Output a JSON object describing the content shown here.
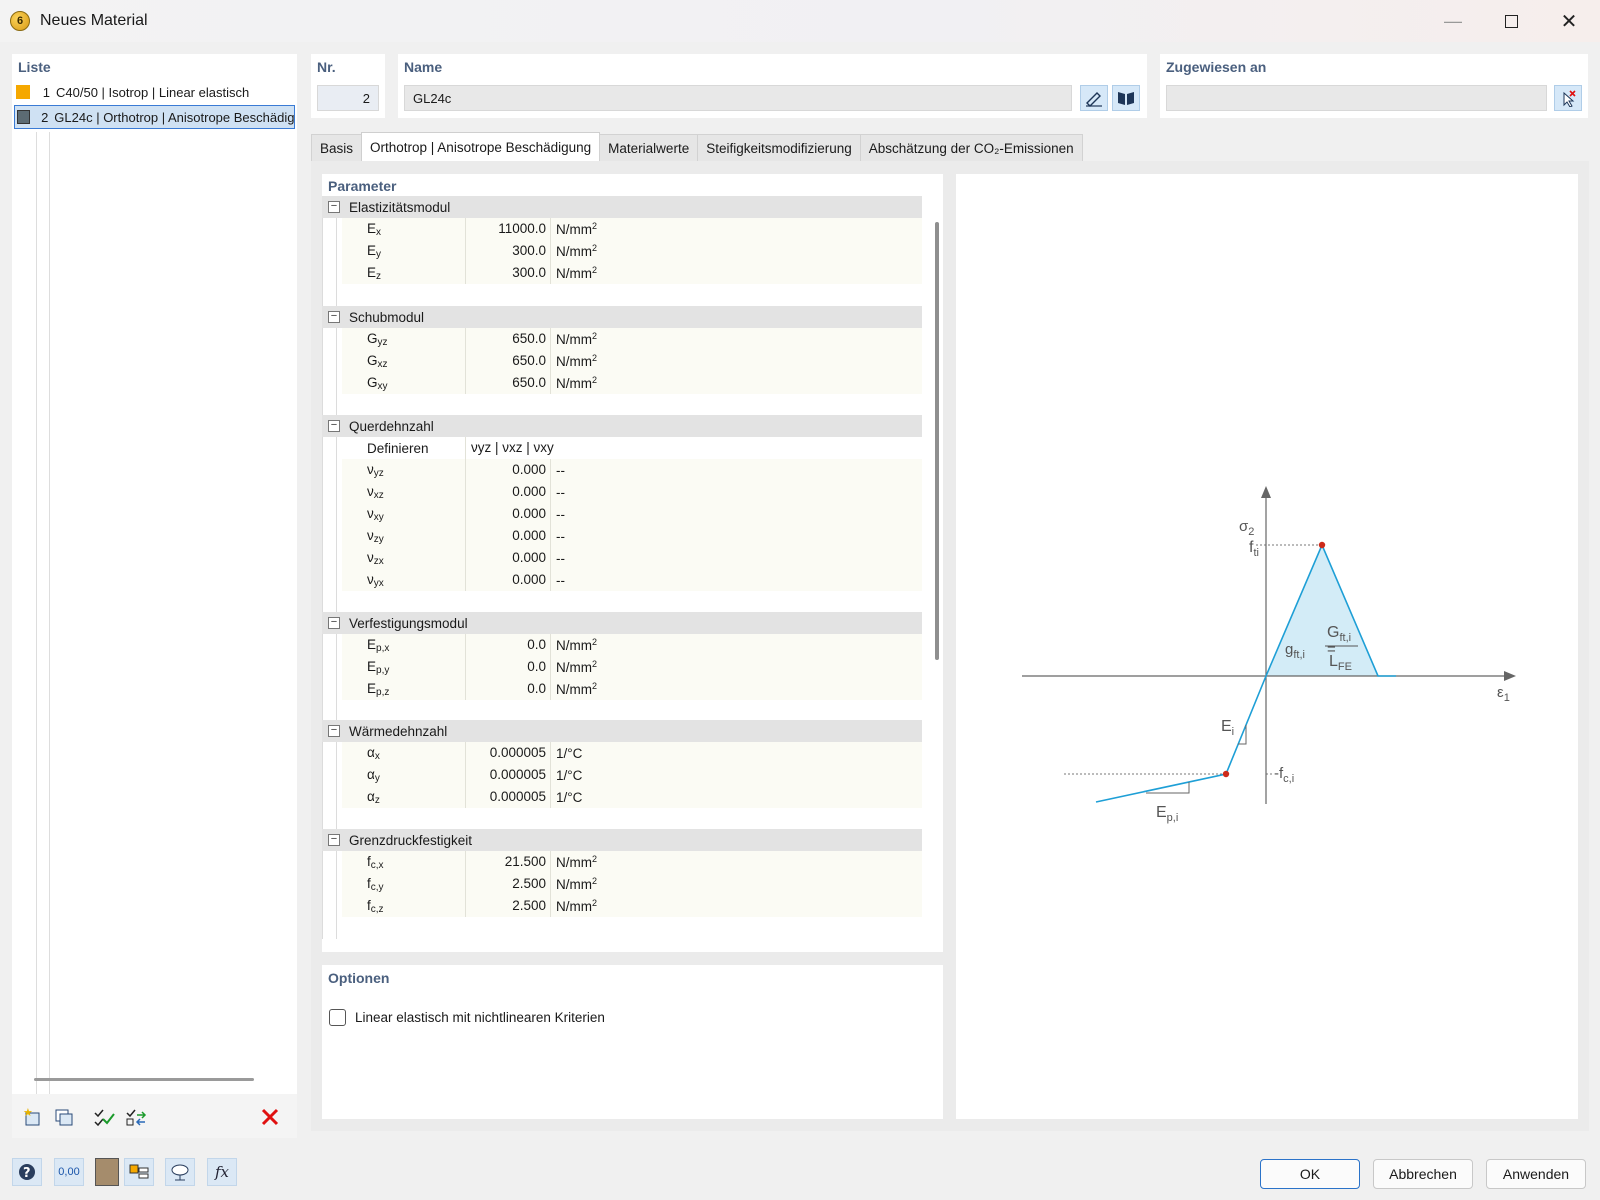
{
  "window": {
    "title": "Neues Material",
    "app_icon_glyph": "6"
  },
  "list": {
    "label": "Liste",
    "items": [
      {
        "num": "1",
        "text": "C40/50 | Isotrop | Linear elastisch",
        "color": "#f5a800"
      },
      {
        "num": "2",
        "text": "GL24c | Orthotrop | Anisotrope Beschädigung",
        "color": "#5c6b73"
      }
    ]
  },
  "header": {
    "nr_label": "Nr.",
    "nr_value": "2",
    "name_label": "Name",
    "name_value": "GL24c",
    "assigned_label": "Zugewiesen an",
    "assigned_value": ""
  },
  "tabs": [
    "Basis",
    "Orthotrop | Anisotrope Beschädigung",
    "Materialwerte",
    "Steifigkeitsmodifizierung",
    "Abschätzung der CO₂-Emissionen"
  ],
  "parameters": {
    "label": "Parameter",
    "sections": [
      {
        "title": "Elastizitätsmodul",
        "rows": [
          {
            "sym": "E",
            "sub": "x",
            "value": "11000.0",
            "unit": "N/mm",
            "exp": "2"
          },
          {
            "sym": "E",
            "sub": "y",
            "value": "300.0",
            "unit": "N/mm",
            "exp": "2"
          },
          {
            "sym": "E",
            "sub": "z",
            "value": "300.0",
            "unit": "N/mm",
            "exp": "2"
          }
        ]
      },
      {
        "title": "Schubmodul",
        "rows": [
          {
            "sym": "G",
            "sub": "yz",
            "value": "650.0",
            "unit": "N/mm",
            "exp": "2"
          },
          {
            "sym": "G",
            "sub": "xz",
            "value": "650.0",
            "unit": "N/mm",
            "exp": "2"
          },
          {
            "sym": "G",
            "sub": "xy",
            "value": "650.0",
            "unit": "N/mm",
            "exp": "2"
          }
        ]
      },
      {
        "title": "Querdehnzahl",
        "define_label": "Definieren",
        "define_value": "νyz | νxz | νxy",
        "rows": [
          {
            "sym": "ν",
            "sub": "yz",
            "value": "0.000",
            "unit": "--",
            "exp": ""
          },
          {
            "sym": "ν",
            "sub": "xz",
            "value": "0.000",
            "unit": "--",
            "exp": ""
          },
          {
            "sym": "ν",
            "sub": "xy",
            "value": "0.000",
            "unit": "--",
            "exp": ""
          },
          {
            "sym": "ν",
            "sub": "zy",
            "value": "0.000",
            "unit": "--",
            "exp": ""
          },
          {
            "sym": "ν",
            "sub": "zx",
            "value": "0.000",
            "unit": "--",
            "exp": ""
          },
          {
            "sym": "ν",
            "sub": "yx",
            "value": "0.000",
            "unit": "--",
            "exp": ""
          }
        ]
      },
      {
        "title": "Verfestigungsmodul",
        "rows": [
          {
            "sym": "E",
            "sub": "p,x",
            "value": "0.0",
            "unit": "N/mm",
            "exp": "2"
          },
          {
            "sym": "E",
            "sub": "p,y",
            "value": "0.0",
            "unit": "N/mm",
            "exp": "2"
          },
          {
            "sym": "E",
            "sub": "p,z",
            "value": "0.0",
            "unit": "N/mm",
            "exp": "2"
          }
        ]
      },
      {
        "title": "Wärmedehnzahl",
        "rows": [
          {
            "sym": "α",
            "sub": "x",
            "value": "0.000005",
            "unit": "1/°C",
            "exp": ""
          },
          {
            "sym": "α",
            "sub": "y",
            "value": "0.000005",
            "unit": "1/°C",
            "exp": ""
          },
          {
            "sym": "α",
            "sub": "z",
            "value": "0.000005",
            "unit": "1/°C",
            "exp": ""
          }
        ]
      },
      {
        "title": "Grenzdruckfestigkeit",
        "rows": [
          {
            "sym": "f",
            "sub": "c,x",
            "value": "21.500",
            "unit": "N/mm",
            "exp": "2"
          },
          {
            "sym": "f",
            "sub": "c,y",
            "value": "2.500",
            "unit": "N/mm",
            "exp": "2"
          },
          {
            "sym": "f",
            "sub": "c,z",
            "value": "2.500",
            "unit": "N/mm",
            "exp": "2"
          }
        ]
      }
    ]
  },
  "options": {
    "label": "Optionen",
    "checkbox_label": "Linear elastisch mit nichtlinearen Kriterien",
    "checked": false
  },
  "diagram": {
    "sigma_label": "σ",
    "sigma_sub": "2",
    "eps_label": "ε",
    "eps_sub": "1",
    "fti_label": "f",
    "fti_sub": "ti",
    "g_label": "g",
    "g_sub": "ft,i",
    "eq_sign": "=",
    "num_label": "G",
    "num_sub": "ft,i",
    "den_label": "L",
    "den_sub": "FE",
    "ei_label": "E",
    "ei_sub": "i",
    "fci_label": "-f",
    "fci_sub": "c,i",
    "epi_label": "E",
    "epi_sub": "p,i",
    "line_color": "#1e9fd6",
    "fill_color": "#d3ecf7",
    "point_color": "#cc2a1a"
  },
  "buttons": {
    "ok": "OK",
    "cancel": "Abbrechen",
    "apply": "Anwenden"
  },
  "bottom_icons": [
    "help-icon",
    "units-icon",
    "color-icon",
    "display-icon",
    "view-icon",
    "formula-icon"
  ],
  "bottom_texts": {
    "units": "0,00",
    "formula": "fx"
  }
}
